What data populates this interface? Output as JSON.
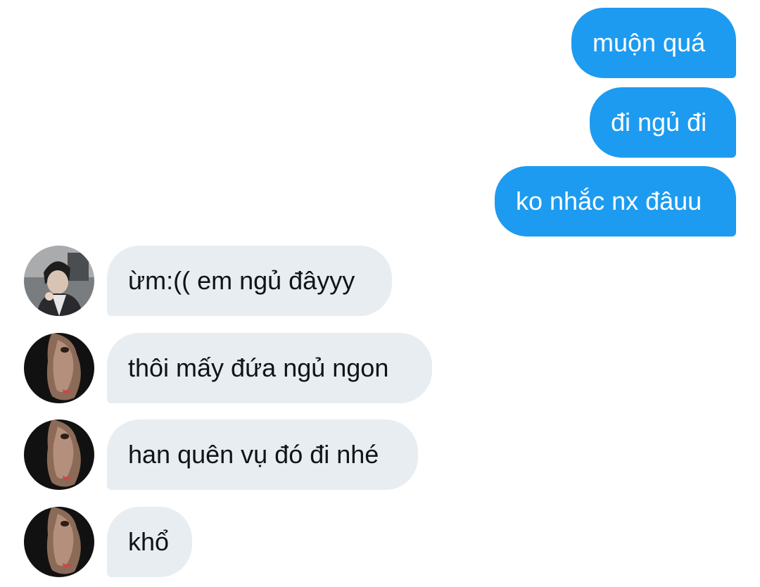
{
  "messages_out": [
    {
      "text": "muộn quá"
    },
    {
      "text": "đi ngủ đi"
    },
    {
      "text": "ko nhắc nx đâuu"
    }
  ],
  "messages_in": [
    {
      "text": "ừm:(( em ngủ đâyyy",
      "avatar": "avatar-photo-boy"
    },
    {
      "text": "thôi mấy đứa ngủ ngon",
      "avatar": "avatar-photo-face"
    },
    {
      "text": "han quên vụ đó đi nhé",
      "avatar": "avatar-photo-face"
    },
    {
      "text": "khổ",
      "avatar": "avatar-photo-face"
    }
  ],
  "colors": {
    "outgoing_bubble": "#1d9bf0",
    "incoming_bubble": "#e8edf1",
    "incoming_text": "#0f1419"
  }
}
